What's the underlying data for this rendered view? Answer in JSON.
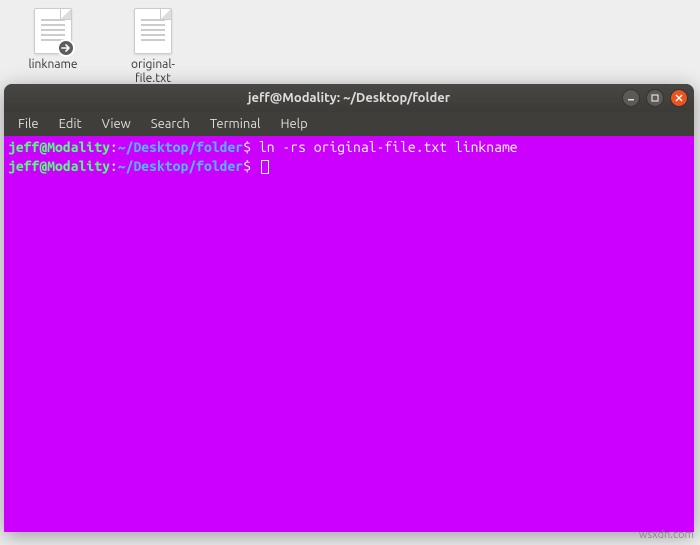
{
  "desktop": {
    "icons": [
      {
        "label": "linkname",
        "is_link": true
      },
      {
        "label": "original-file.txt",
        "is_link": false
      }
    ]
  },
  "terminal": {
    "title": "jeff@Modality: ~/Desktop/folder",
    "menu": [
      "File",
      "Edit",
      "View",
      "Search",
      "Terminal",
      "Help"
    ],
    "lines": [
      {
        "user": "jeff@Modality",
        "sep1": ":",
        "path": "~/Desktop/folder",
        "sep2": "$",
        "command": " ln -rs original-file.txt linkname"
      },
      {
        "user": "jeff@Modality",
        "sep1": ":",
        "path": "~/Desktop/folder",
        "sep2": "$",
        "command": " "
      }
    ],
    "colors": {
      "background": "#cc00ff",
      "user": "#56ff7a",
      "path": "#55b6ff",
      "text": "#ffffff"
    }
  },
  "watermark": "wsxdn.com"
}
